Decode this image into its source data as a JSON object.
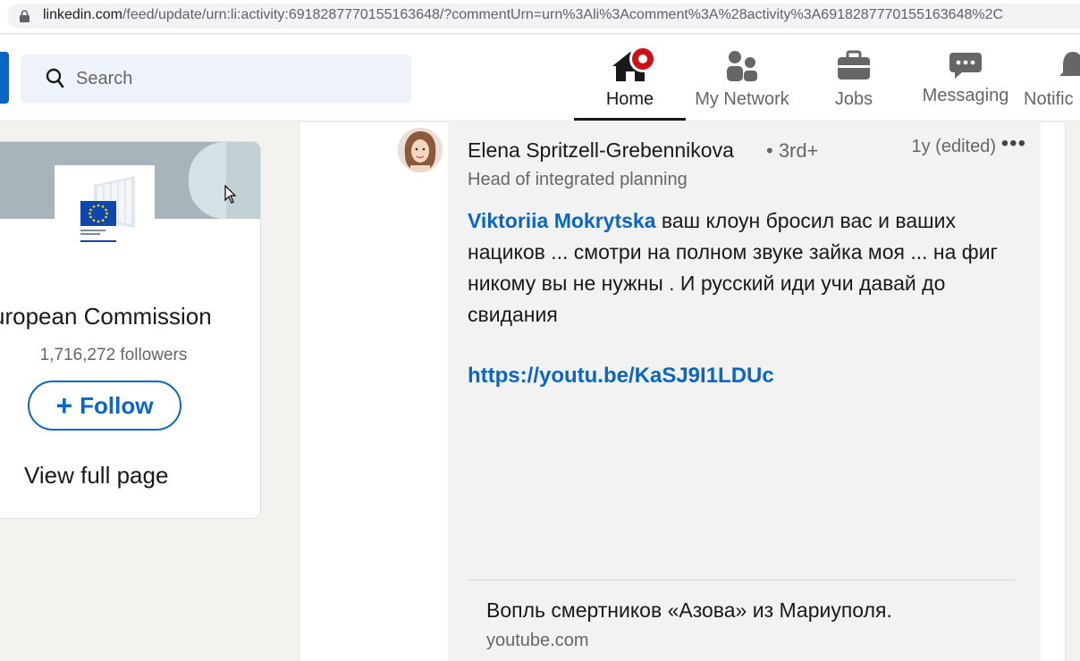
{
  "browser": {
    "url_host": "linkedin.com",
    "url_rest": "/feed/update/urn:li:activity:6918287770155163648/?commentUrn=urn%3Ali%3Acomment%3A%28activity%3A6918287770155163648%2C"
  },
  "nav": {
    "search_placeholder": "Search",
    "items": [
      {
        "label": "Home",
        "icon": "home-icon",
        "active": true
      },
      {
        "label": "My Network",
        "icon": "network-icon"
      },
      {
        "label": "Jobs",
        "icon": "jobs-icon"
      },
      {
        "label": "Messaging",
        "icon": "messaging-icon"
      },
      {
        "label": "Notific",
        "icon": "bell-icon"
      }
    ],
    "accent": "#0a66c2",
    "badge_color": "#cc1016"
  },
  "org_card": {
    "name": "uropean Commission",
    "followers": "1,716,272 followers",
    "follow_label": "Follow",
    "view_full": "View full page"
  },
  "comment": {
    "author": "Elena Spritzell-Grebennikova",
    "degree": "• 3rd+",
    "time": "1y (edited)",
    "more": "•••",
    "headline": "Head of integrated planning",
    "mention": "Viktoriia Mokrytska",
    "text": " ваш клоун бросил вас и ваших нациков ... смотри на полном звуке зайка моя ... на фиг никому вы не нужны . И русский иди учи давай до свидания",
    "link": "https://youtu.be/KaSJ9I1LDUc",
    "preview_title": "Вопль смертников «Азова» из Мариуполя.",
    "preview_source": "youtube.com"
  }
}
